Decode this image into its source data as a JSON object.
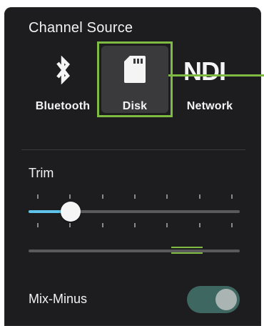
{
  "panel": {
    "section_title": "Channel Source",
    "sources": [
      {
        "label": "Bluetooth",
        "icon": "bluetooth-icon",
        "selected": false
      },
      {
        "label": "Disk",
        "icon": "sd-card-icon",
        "selected": true
      },
      {
        "label": "Network",
        "icon": "ndi-logo",
        "selected": false
      }
    ],
    "ndi_logo_text": "NDI",
    "trim": {
      "label": "Trim",
      "value_fraction": 0.2
    },
    "meter": {
      "marker_fraction": 0.75
    },
    "mix_minus": {
      "label": "Mix-Minus",
      "enabled": true
    }
  },
  "colors": {
    "panel_bg": "#1d1d1f",
    "highlight_green": "#7fba42",
    "slider_fill_blue": "#5ec2ea",
    "toggle_on_bg": "#3f6761"
  }
}
